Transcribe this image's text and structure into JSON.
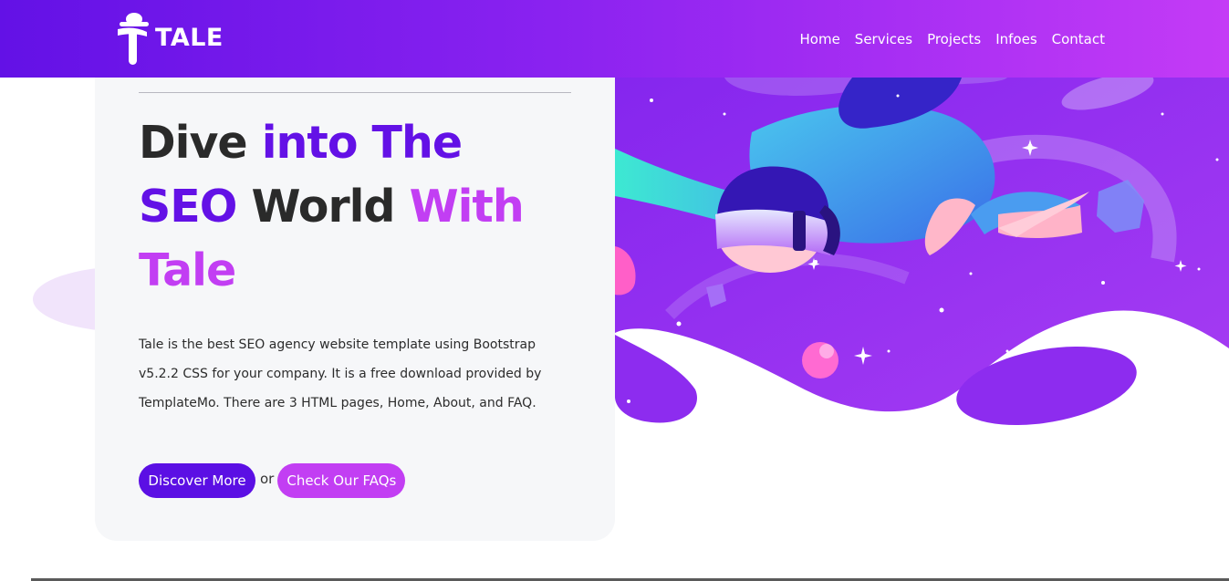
{
  "navbar": {
    "brand": "TALE",
    "links": [
      "Home",
      "Services",
      "Projects",
      "Infoes",
      "Contact"
    ]
  },
  "hero": {
    "headline": {
      "w1": "Dive",
      "w2": "into The",
      "w3": "SEO",
      "w4": "World",
      "w5": "With",
      "w6": "Tale"
    },
    "description": "Tale is the best SEO agency website template using Bootstrap v5.2.2 CSS for your company. It is a free download provided by TemplateMo. There are 3 HTML pages, Home, About, and FAQ.",
    "primary_button": "Discover More",
    "or_text": "or",
    "secondary_button": "Check Our FAQs"
  },
  "icons": {
    "logo": "hat-figure-logo-icon"
  },
  "colors": {
    "primary": "#6311e6",
    "accent": "#c23ef3",
    "card_bg": "#f6f7f9",
    "text_dark": "#2a2a2a"
  }
}
